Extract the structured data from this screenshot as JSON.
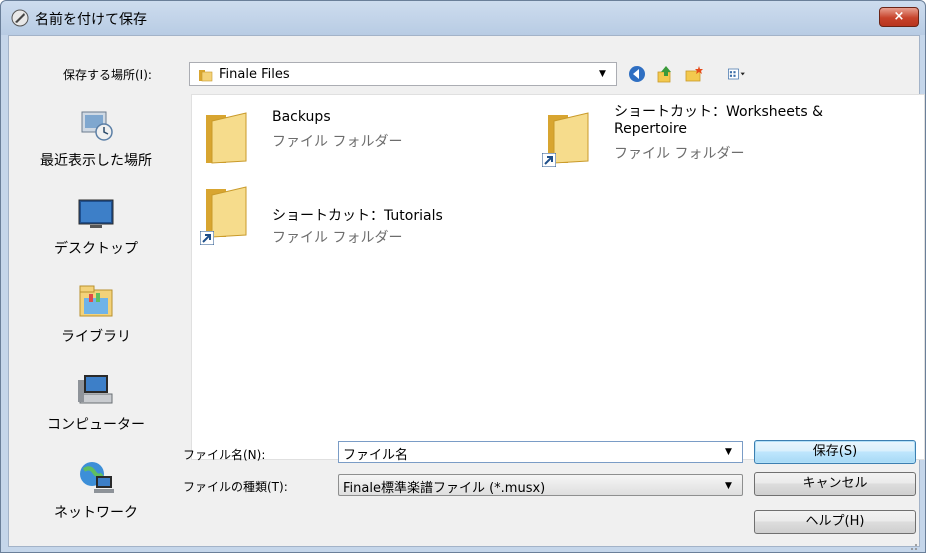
{
  "window": {
    "title": "名前を付けて保存",
    "close_label": "×",
    "colors": {
      "titlebar": "#c5d6ea",
      "close": "#c7432b",
      "primary_button": "#bee6fd"
    }
  },
  "toolbar": {
    "save_in_label": "保存する場所(I):",
    "save_in_value": "Finale Files",
    "icons": [
      "back-icon",
      "up-folder-icon",
      "new-folder-icon",
      "view-menu-icon"
    ]
  },
  "places": [
    {
      "label": "最近表示した場所",
      "icon": "recent-places-icon"
    },
    {
      "label": "デスクトップ",
      "icon": "desktop-icon"
    },
    {
      "label": "ライブラリ",
      "icon": "libraries-icon"
    },
    {
      "label": "コンピューター",
      "icon": "computer-icon"
    },
    {
      "label": "ネットワーク",
      "icon": "network-icon"
    }
  ],
  "files": [
    {
      "name": "Backups",
      "type": "ファイル フォルダー",
      "shortcut": false
    },
    {
      "name_line1": "ショートカット：Worksheets &",
      "name_line2": "Repertoire",
      "type": "ファイル フォルダー",
      "shortcut": true
    },
    {
      "name": "ショートカット：Tutorials",
      "type": "ファイル フォルダー",
      "shortcut": true
    }
  ],
  "form": {
    "filename_label": "ファイル名(N):",
    "filename_value": "ファイル名",
    "filetype_label": "ファイルの種類(T):",
    "filetype_value": "Finale標準楽譜ファイル (*.musx)"
  },
  "buttons": {
    "save": "保存(S)",
    "cancel": "キャンセル",
    "help": "ヘルプ(H)"
  }
}
